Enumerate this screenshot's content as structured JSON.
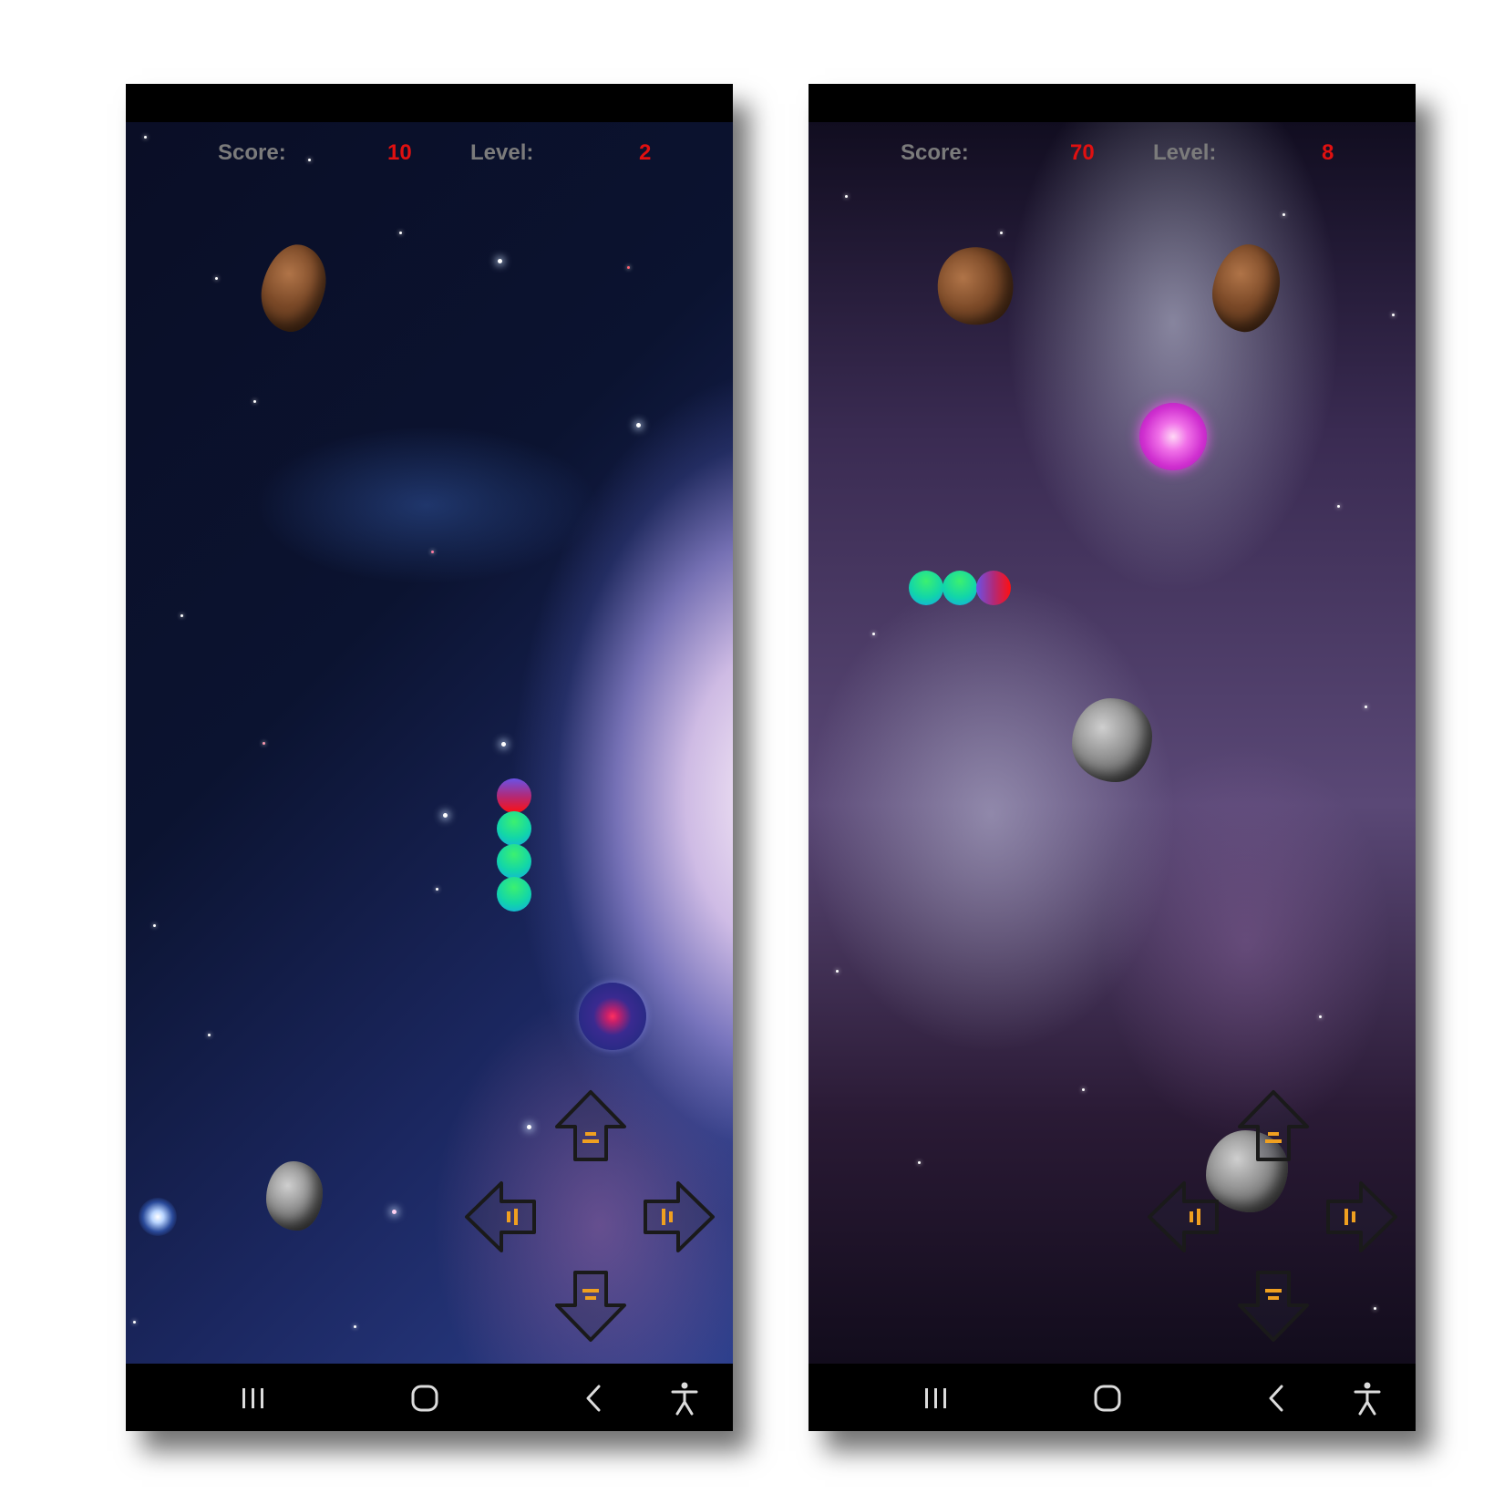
{
  "screens": [
    {
      "hud": {
        "score_label": "Score:",
        "score_value": "10",
        "level_label": "Level:",
        "level_value": "2"
      },
      "theme": "galaxy-blue",
      "snake": {
        "direction": "up",
        "segments": 4
      }
    },
    {
      "hud": {
        "score_label": "Score:",
        "score_value": "70",
        "level_label": "Level:",
        "level_value": "8"
      },
      "theme": "nebula-purple",
      "snake": {
        "direction": "right",
        "segments": 3
      }
    }
  ],
  "colors": {
    "hud_label": "#7b7b7b",
    "hud_value": "#e01010",
    "snake_body": "#12d6a8",
    "snake_head": "#ff1010",
    "arrow_outline": "#1a1a1a",
    "arrow_accent": "#f0a020"
  },
  "icons": {
    "controls": [
      "arrow-up-icon",
      "arrow-left-icon",
      "arrow-right-icon",
      "arrow-down-icon"
    ],
    "navigation": [
      "recent-apps-icon",
      "home-icon",
      "back-icon",
      "accessibility-icon"
    ]
  }
}
